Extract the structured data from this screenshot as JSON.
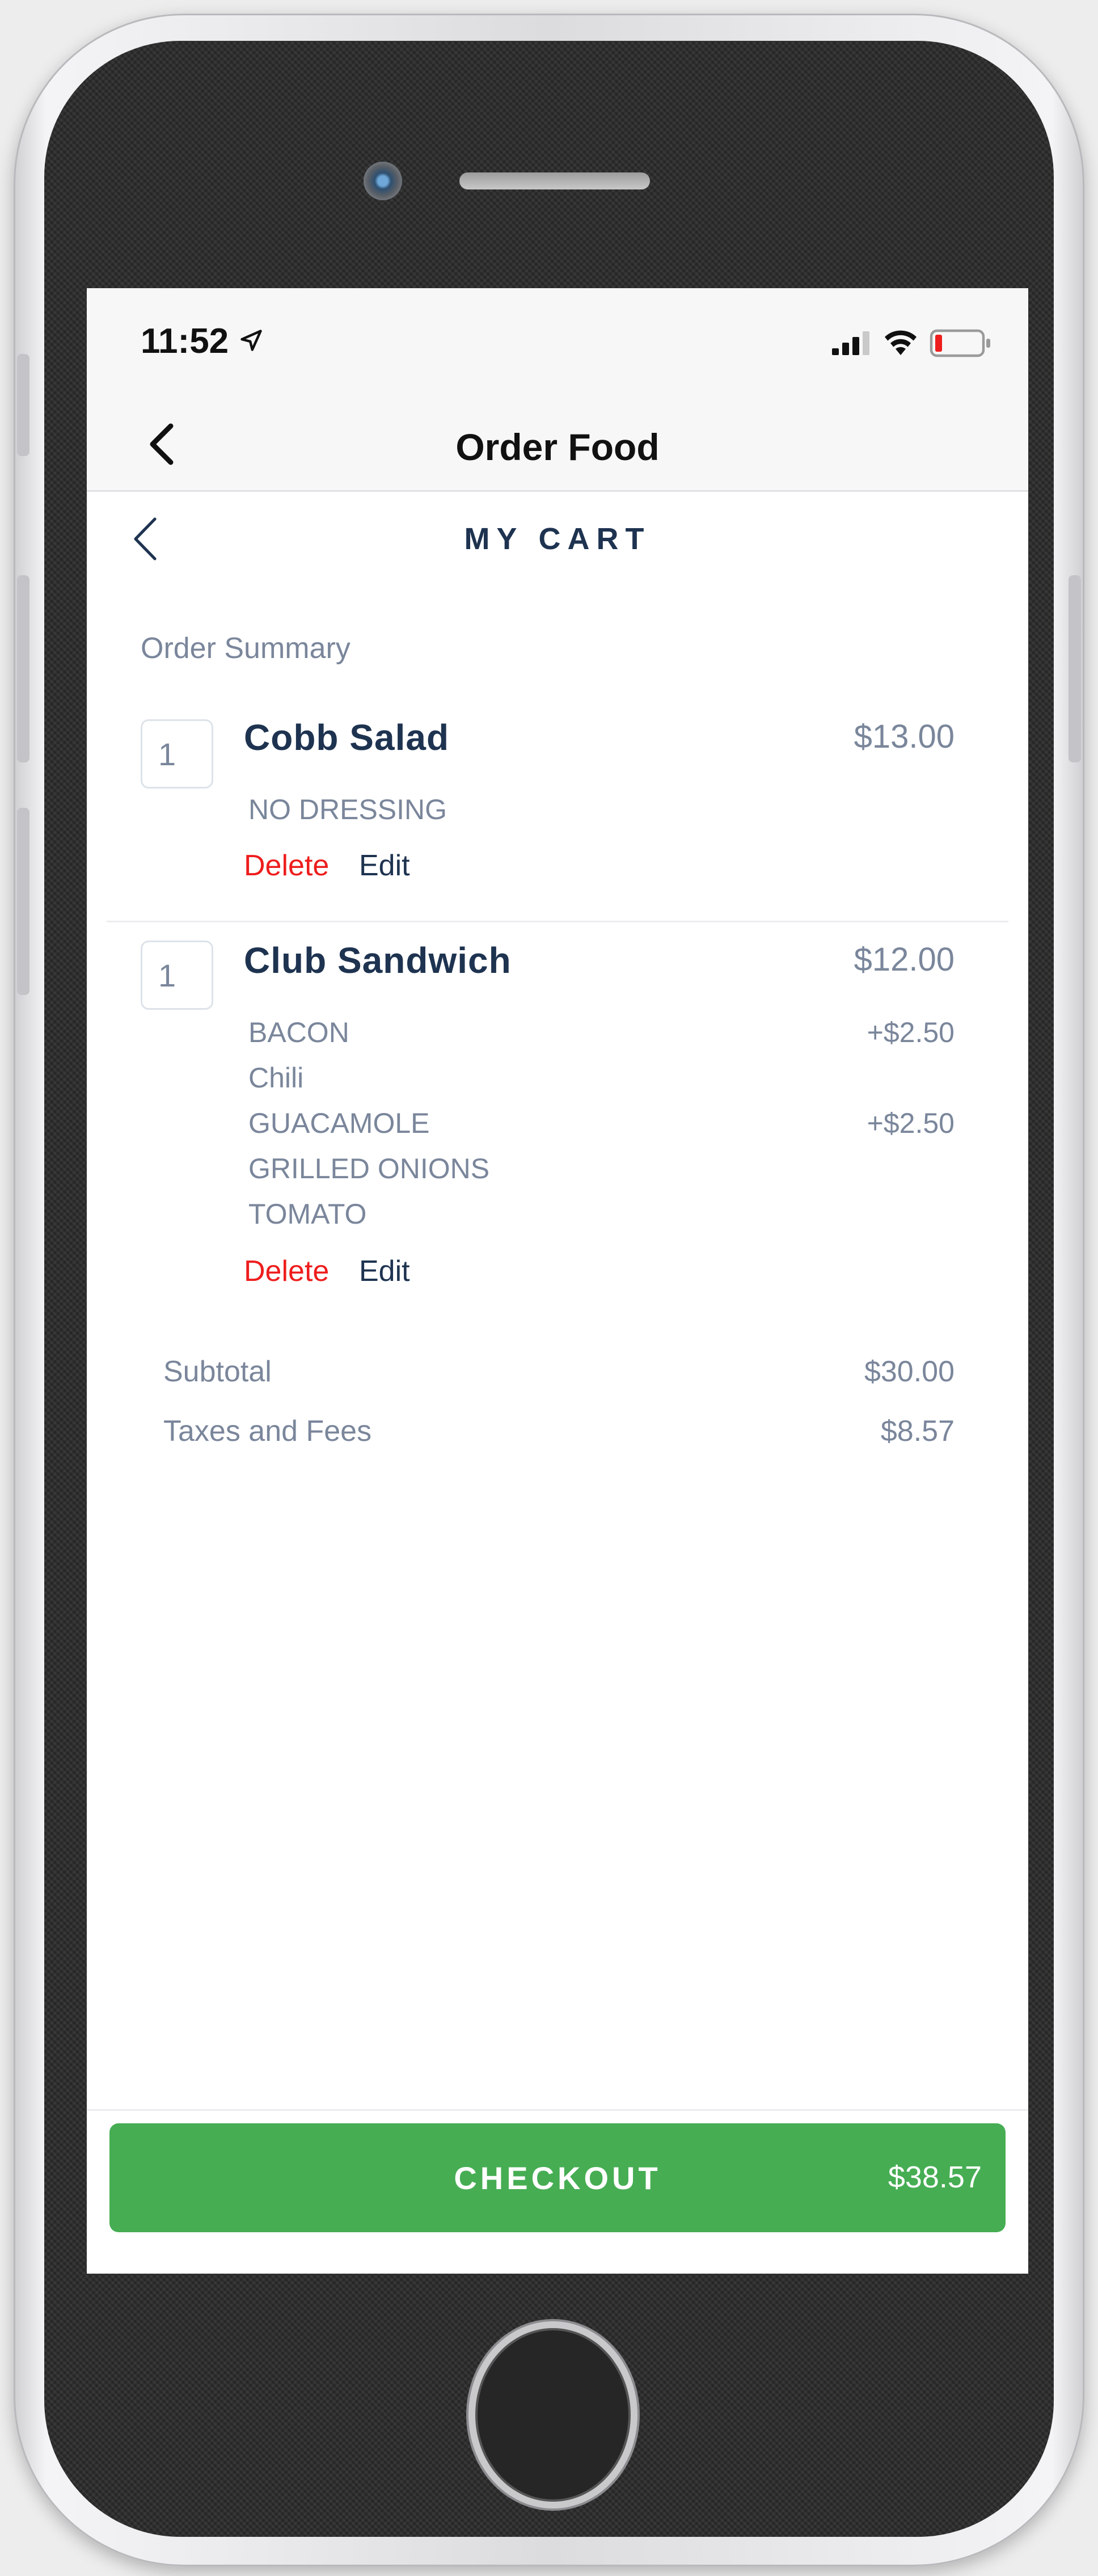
{
  "status_bar": {
    "time": "11:52"
  },
  "nav": {
    "title": "Order Food"
  },
  "cart": {
    "title": "MY CART",
    "summary_label": "Order Summary"
  },
  "items": [
    {
      "quantity": "1",
      "name": "Cobb Salad",
      "price": "$13.00",
      "modifiers": [
        {
          "name": "NO DRESSING",
          "price": ""
        }
      ],
      "delete_label": "Delete",
      "edit_label": "Edit"
    },
    {
      "quantity": "1",
      "name": "Club Sandwich",
      "price": "$12.00",
      "modifiers": [
        {
          "name": "BACON",
          "price": "+$2.50"
        },
        {
          "name": "Chili",
          "price": ""
        },
        {
          "name": "GUACAMOLE",
          "price": "+$2.50"
        },
        {
          "name": "GRILLED ONIONS",
          "price": ""
        },
        {
          "name": "TOMATO",
          "price": ""
        }
      ],
      "delete_label": "Delete",
      "edit_label": "Edit"
    }
  ],
  "totals": {
    "subtotal_label": "Subtotal",
    "subtotal_value": "$30.00",
    "taxes_label": "Taxes and Fees",
    "taxes_value": "$8.57"
  },
  "checkout": {
    "label": "CHECKOUT",
    "total": "$38.57"
  },
  "colors": {
    "accent_green": "#46ad53",
    "delete_red": "#ee1d1d",
    "navy_text": "#1e3350",
    "muted_text": "#7a869b"
  },
  "icons": [
    "location-arrow-icon",
    "cellular-signal-icon",
    "wifi-icon",
    "battery-low-icon",
    "chevron-left-icon"
  ]
}
